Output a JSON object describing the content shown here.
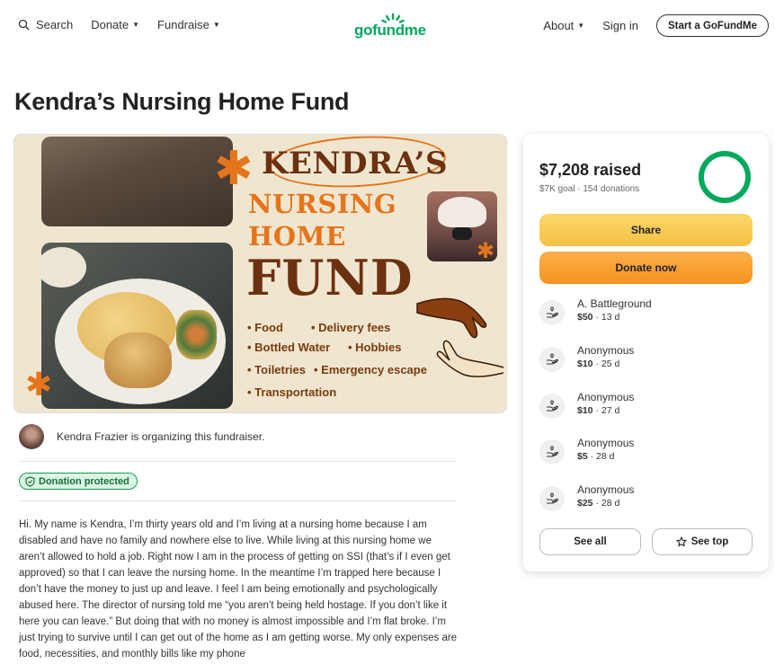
{
  "header": {
    "search_label": "Search",
    "donate_label": "Donate",
    "fundraise_label": "Fundraise",
    "logo_text": "gofundme",
    "about_label": "About",
    "signin_label": "Sign in",
    "start_label": "Start a GoFundMe"
  },
  "page_title": "Kendra’s Nursing Home Fund",
  "hero": {
    "line1": "KENDRA’S",
    "line2": "NURSING",
    "line3": "HOME",
    "line4": "FUND",
    "items": [
      "• Food",
      "• Delivery fees",
      "• Bottled Water",
      "• Hobbies",
      "• Toiletries",
      "• Emergency escape",
      "• Transportation"
    ]
  },
  "organizer": {
    "text": "Kendra Frazier is organizing this fundraiser."
  },
  "badge_label": "Donation protected",
  "story": "Hi. My name is Kendra, I’m thirty years old and I’m living at a nursing home because I am disabled and have no family and nowhere else to live. While living at this nursing home we aren’t allowed to hold a job. Right now I am in the process of getting on SSI (that’s if I even get approved) so that I can leave the nursing home. In the meantime I’m trapped here because I don’t have the money to just up and leave. I feel I am being emotionally and psychologically abused here. The director of nursing told me “you aren’t being held hostage. If you don’t like it here you can leave.” But doing that with no money is almost impossible and I’m flat broke. I’m just trying to survive until I can get out of the home as I am getting worse. My only expenses are food, necessities, and monthly bills like my phone",
  "card": {
    "raised": "$7,208 raised",
    "goal": "$7K goal",
    "donations_count": "154 donations",
    "progress_fraction": 1.0,
    "share_label": "Share",
    "donate_label": "Donate now",
    "donations": [
      {
        "name": "A. Battleground",
        "amount": "$50",
        "age": "13 d"
      },
      {
        "name": "Anonymous",
        "amount": "$10",
        "age": "25 d"
      },
      {
        "name": "Anonymous",
        "amount": "$10",
        "age": "27 d"
      },
      {
        "name": "Anonymous",
        "amount": "$5",
        "age": "28 d"
      },
      {
        "name": "Anonymous",
        "amount": "$25",
        "age": "28 d"
      }
    ],
    "see_all_label": "See all",
    "see_top_label": "See top"
  },
  "colors": {
    "brand_green": "#02a95c",
    "share_yellow": "#f4c243",
    "donate_orange": "#f6921e",
    "hero_orange": "#e5751c",
    "hero_brown": "#6b3110"
  }
}
